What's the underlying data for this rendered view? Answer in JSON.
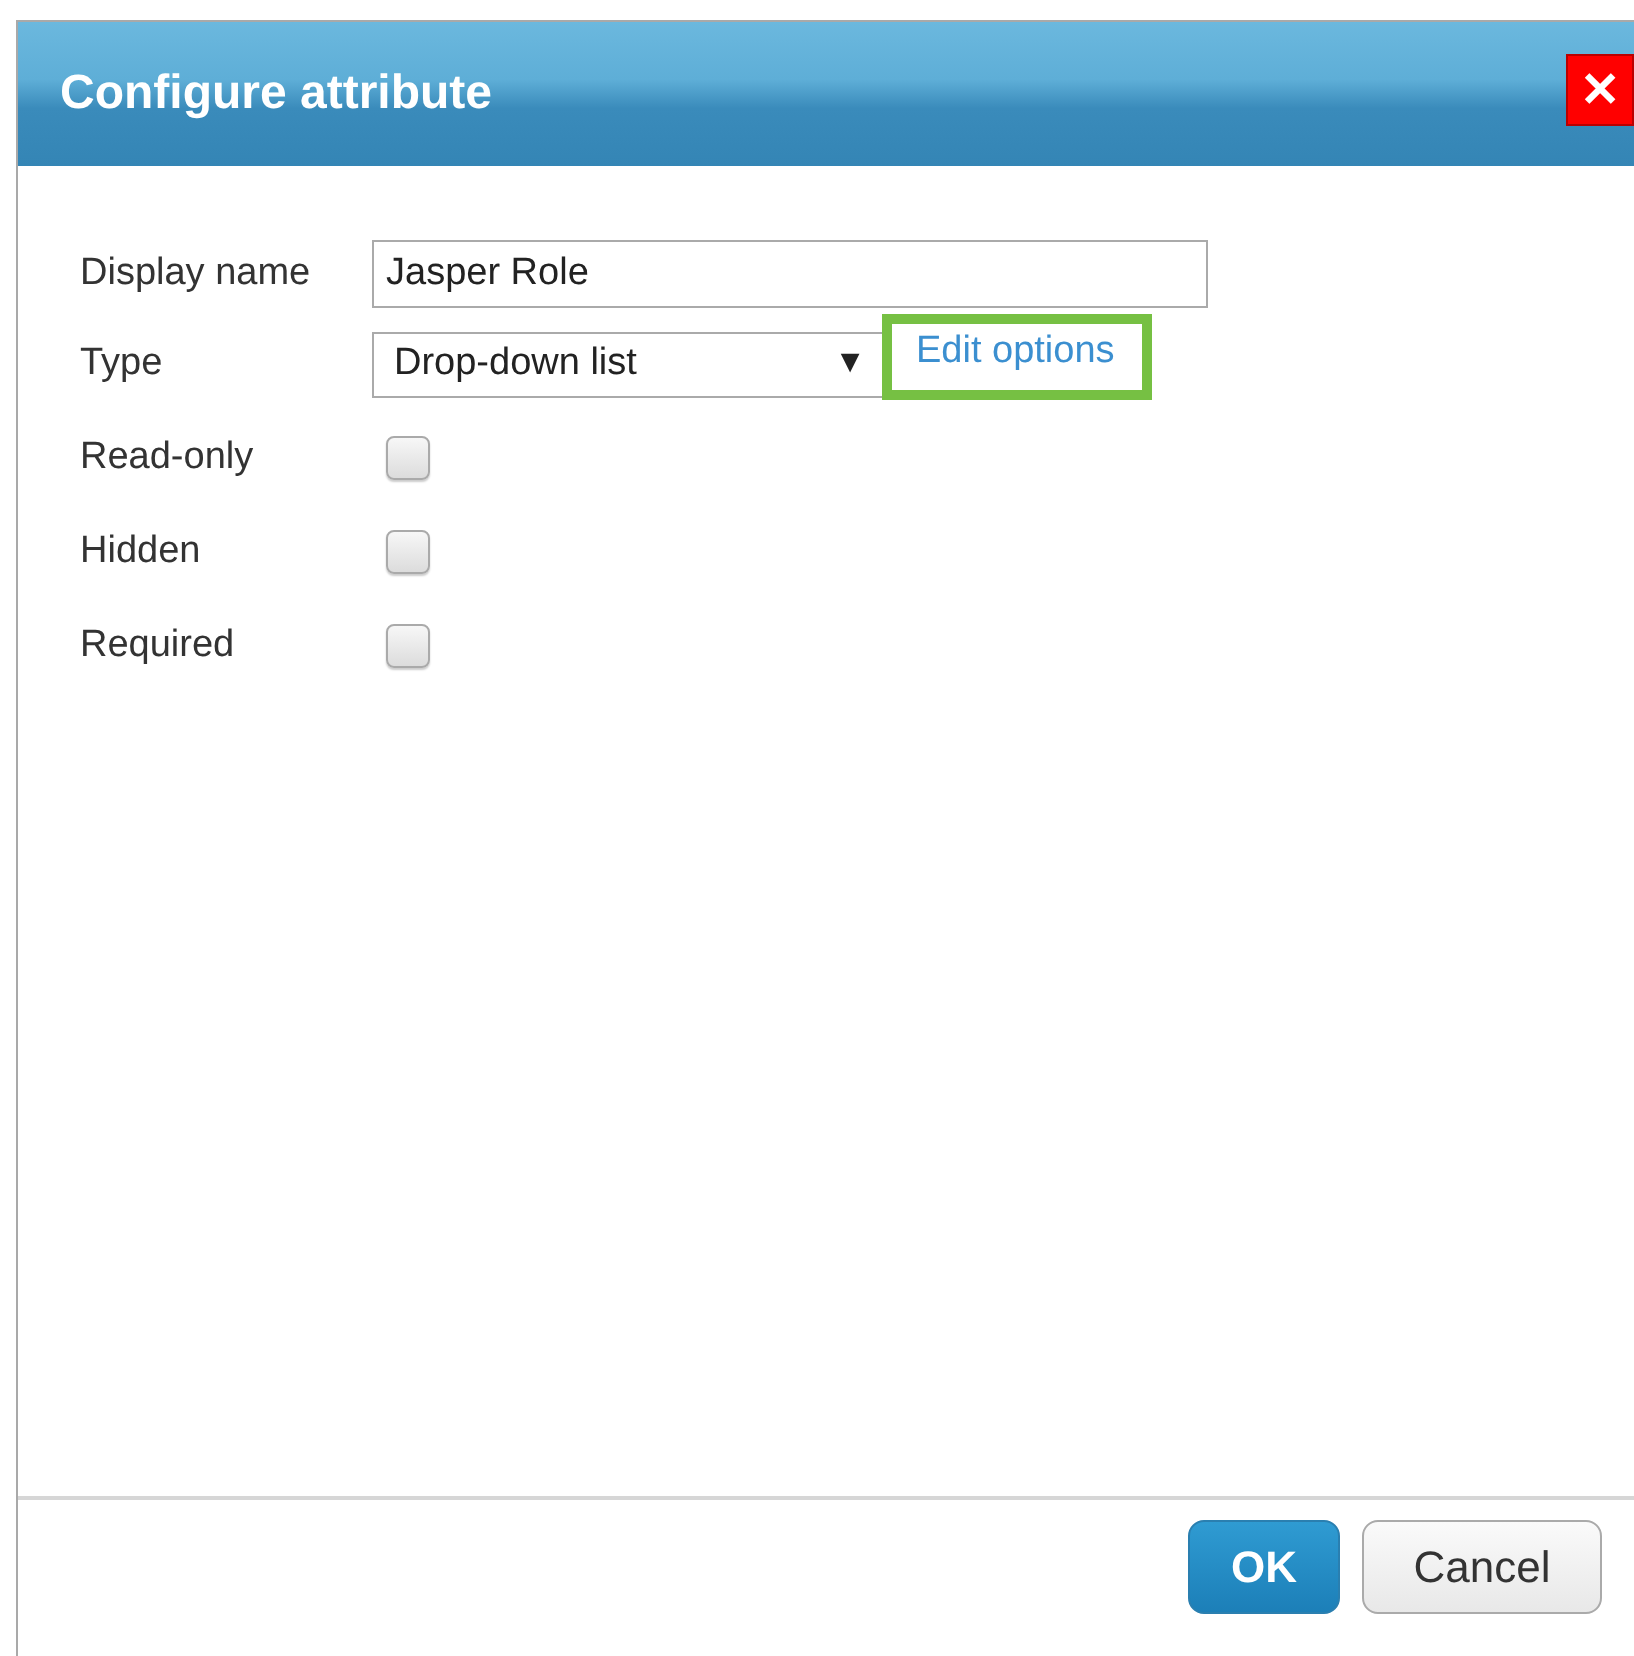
{
  "window": {
    "title": "Configure attribute",
    "close": "✕"
  },
  "fields": [
    {
      "kind": "text",
      "label": "Display name",
      "value": "Jasper Role"
    },
    {
      "kind": "select",
      "label": "Type",
      "value": "Drop-down list",
      "caret": "▼",
      "link": "Edit options"
    },
    {
      "kind": "checkbox",
      "label": "Read-only",
      "checked": false
    },
    {
      "kind": "checkbox",
      "label": "Hidden",
      "checked": false
    },
    {
      "kind": "checkbox",
      "label": "Required",
      "checked": false
    }
  ],
  "buttons": [
    {
      "label": "OK",
      "kind": "primary"
    },
    {
      "label": "Cancel",
      "kind": "secondary"
    }
  ]
}
